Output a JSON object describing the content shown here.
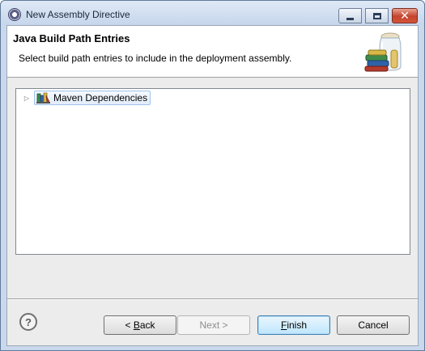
{
  "window": {
    "title": "New Assembly Directive",
    "controls": {
      "minimize": "minimize",
      "maximize": "maximize",
      "close": "✕"
    }
  },
  "header": {
    "title": "Java Build Path Entries",
    "description": "Select build path entries to include in the deployment assembly.",
    "icon": "library-jar-icon"
  },
  "tree": {
    "items": [
      {
        "label": "Maven Dependencies",
        "icon": "library-icon",
        "expanded": false,
        "selected": true
      }
    ]
  },
  "footer": {
    "help": "?",
    "buttons": {
      "back": {
        "mnemonic": "B",
        "rest": "ack",
        "prefix": "< "
      },
      "next": {
        "label": "Next >",
        "enabled": false
      },
      "finish": {
        "mnemonic": "F",
        "rest": "inish"
      },
      "cancel": {
        "label": "Cancel"
      }
    }
  }
}
